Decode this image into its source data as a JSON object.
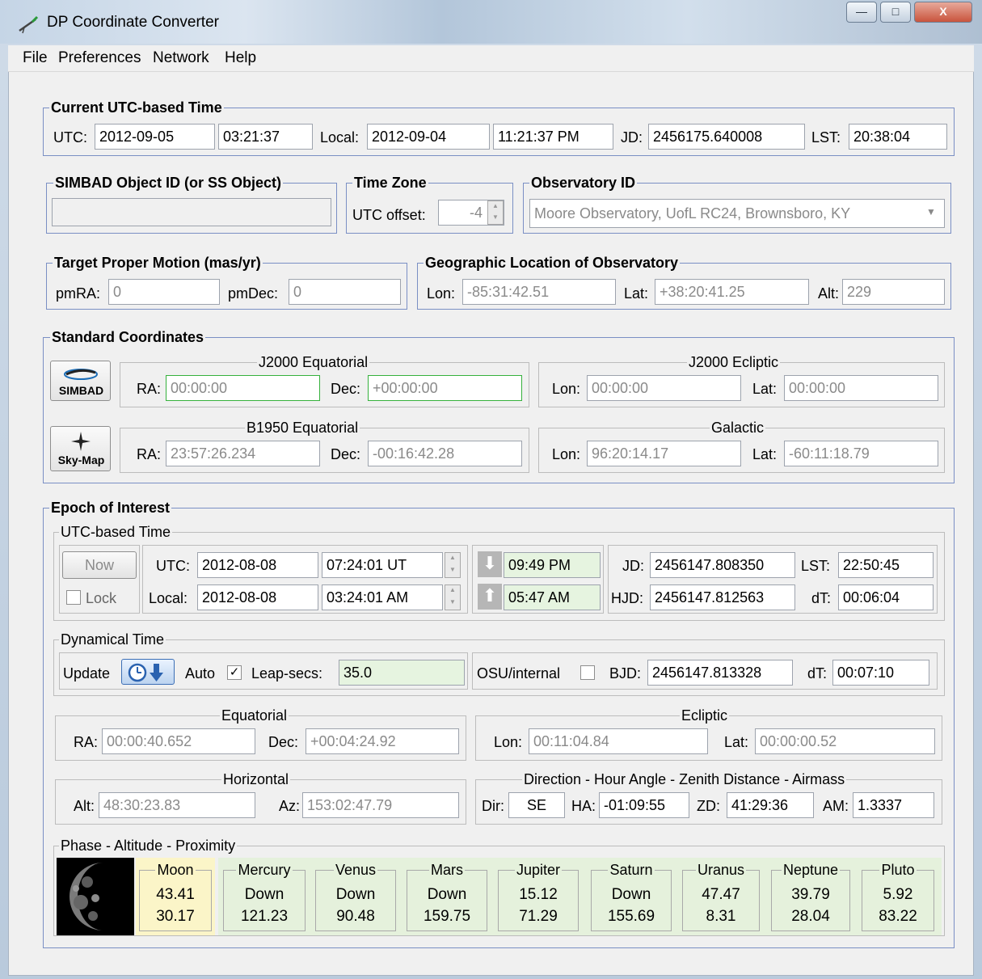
{
  "window": {
    "title": "DP Coordinate Converter",
    "minimize": "—",
    "maximize": "□",
    "close": "X"
  },
  "menu": [
    "File",
    "Preferences",
    "Network",
    "Help"
  ],
  "current_time": {
    "title": "Current UTC-based Time",
    "utc_label": "UTC:",
    "utc_date": "2012-09-05",
    "utc_time": "03:21:37",
    "local_label": "Local:",
    "local_date": "2012-09-04",
    "local_time": "11:21:37 PM",
    "jd_label": "JD:",
    "jd": "2456175.640008",
    "lst_label": "LST:",
    "lst": "20:38:04"
  },
  "simbad": {
    "title": "SIMBAD Object ID (or SS Object)",
    "value": ""
  },
  "timezone": {
    "title": "Time Zone",
    "label": "UTC offset:",
    "value": "-4"
  },
  "observatory": {
    "title": "Observatory ID",
    "value": "Moore Observatory, UofL RC24, Brownsboro, KY"
  },
  "proper_motion": {
    "title": "Target Proper Motion (mas/yr)",
    "pmra_label": "pmRA:",
    "pmra": "0",
    "pmdec_label": "pmDec:",
    "pmdec": "0"
  },
  "geo": {
    "title": "Geographic Location of Observatory",
    "lon_label": "Lon:",
    "lon": "-85:31:42.51",
    "lat_label": "Lat:",
    "lat": "+38:20:41.25",
    "alt_label": "Alt:",
    "alt": "229"
  },
  "standard": {
    "title": "Standard Coordinates",
    "simbad_btn": "SIMBAD",
    "skymap_btn": "Sky-Map",
    "j2000_eq": {
      "title": "J2000 Equatorial",
      "ra_label": "RA:",
      "ra": "00:00:00",
      "dec_label": "Dec:",
      "dec": "+00:00:00"
    },
    "j2000_ec": {
      "title": "J2000 Ecliptic",
      "lon_label": "Lon:",
      "lon": "00:00:00",
      "lat_label": "Lat:",
      "lat": "00:00:00"
    },
    "b1950_eq": {
      "title": "B1950 Equatorial",
      "ra_label": "RA:",
      "ra": "23:57:26.234",
      "dec_label": "Dec:",
      "dec": "-00:16:42.28"
    },
    "galactic": {
      "title": "Galactic",
      "lon_label": "Lon:",
      "lon": "96:20:14.17",
      "lat_label": "Lat:",
      "lat": "-60:11:18.79"
    }
  },
  "epoch": {
    "title": "Epoch of Interest",
    "utc": {
      "title": "UTC-based Time",
      "now_btn": "Now",
      "lock_label": "Lock",
      "utc_label": "UTC:",
      "utc_date": "2012-08-08",
      "utc_time": "07:24:01 UT",
      "local_label": "Local:",
      "local_date": "2012-08-08",
      "local_time": "03:24:01 AM",
      "set_time": "09:49 PM",
      "rise_time": "05:47 AM",
      "jd_label": "JD:",
      "jd": "2456147.808350",
      "lst_label": "LST:",
      "lst": "22:50:45",
      "hjd_label": "HJD:",
      "hjd": "2456147.812563",
      "dt_label": "dT:",
      "dt": "00:06:04"
    },
    "dynamical": {
      "title": "Dynamical Time",
      "update_label": "Update",
      "auto_label": "Auto",
      "auto_checked": "✓",
      "leap_label": "Leap-secs:",
      "leap": "35.0",
      "osu_label": "OSU/internal",
      "bjd_label": "BJD:",
      "bjd": "2456147.813328",
      "dt_label": "dT:",
      "dt": "00:07:10"
    },
    "equatorial": {
      "title": "Equatorial",
      "ra_label": "RA:",
      "ra": "00:00:40.652",
      "dec_label": "Dec:",
      "dec": "+00:04:24.92"
    },
    "ecliptic": {
      "title": "Ecliptic",
      "lon_label": "Lon:",
      "lon": "00:11:04.84",
      "lat_label": "Lat:",
      "lat": "00:00:00.52"
    },
    "horizontal": {
      "title": "Horizontal",
      "alt_label": "Alt:",
      "alt": "48:30:23.83",
      "az_label": "Az:",
      "az": "153:02:47.79"
    },
    "direction": {
      "title": "Direction - Hour Angle - Zenith Distance - Airmass",
      "dir_label": "Dir:",
      "dir": "SE",
      "ha_label": "HA:",
      "ha": "-01:09:55",
      "zd_label": "ZD:",
      "zd": "41:29:36",
      "am_label": "AM:",
      "am": "1.3337"
    },
    "phase": {
      "title": "Phase - Altitude - Proximity",
      "bodies": [
        {
          "name": "Moon",
          "v1": "43.41",
          "v2": "30.17"
        },
        {
          "name": "Mercury",
          "v1": "Down",
          "v2": "121.23"
        },
        {
          "name": "Venus",
          "v1": "Down",
          "v2": "90.48"
        },
        {
          "name": "Mars",
          "v1": "Down",
          "v2": "159.75"
        },
        {
          "name": "Jupiter",
          "v1": "15.12",
          "v2": "71.29"
        },
        {
          "name": "Saturn",
          "v1": "Down",
          "v2": "155.69"
        },
        {
          "name": "Uranus",
          "v1": "47.47",
          "v2": "8.31"
        },
        {
          "name": "Neptune",
          "v1": "39.79",
          "v2": "28.04"
        },
        {
          "name": "Pluto",
          "v1": "5.92",
          "v2": "83.22"
        }
      ]
    }
  },
  "colors": {
    "accent_border": "#7a8fc4",
    "valid_border": "#35b13c",
    "light_green": "#e6f4e0",
    "moon_bg": "#fbf5c8"
  }
}
